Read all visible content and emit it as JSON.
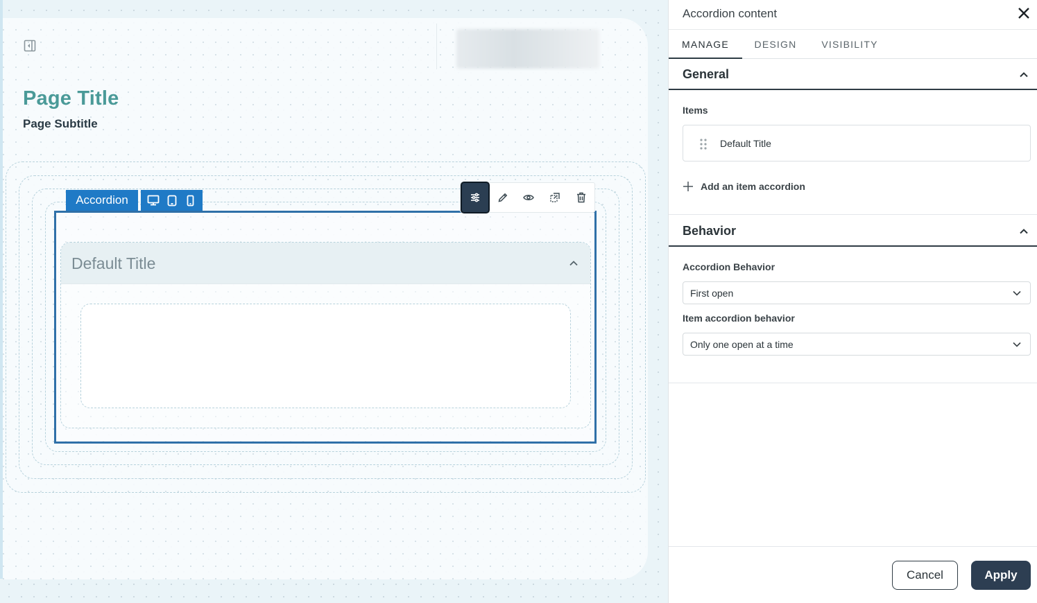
{
  "canvas": {
    "page_title": "Page Title",
    "page_subtitle": "Page Subtitle",
    "collapse_icon": "panel-collapse-icon",
    "component": {
      "tag_label": "Accordion",
      "device_icons": [
        "desktop-icon",
        "tablet-icon",
        "mobile-icon"
      ],
      "toolbar_icons": [
        "settings-sliders-icon",
        "pencil-icon",
        "eye-icon",
        "duplicate-icon",
        "trash-icon"
      ],
      "item_title": "Default Title"
    }
  },
  "panel": {
    "title": "Accordion content",
    "tabs": [
      {
        "label": "MANAGE",
        "active": true
      },
      {
        "label": "DESIGN",
        "active": false
      },
      {
        "label": "VISIBILITY",
        "active": false
      }
    ],
    "general": {
      "title": "General",
      "items_label": "Items",
      "items": [
        {
          "title": "Default Title"
        }
      ],
      "add_item_label": "Add an item accordion"
    },
    "behavior": {
      "title": "Behavior",
      "accordion_behavior_label": "Accordion Behavior",
      "accordion_behavior_value": "First open",
      "item_behavior_label": "Item accordion behavior",
      "item_behavior_value": "Only one open at a time"
    },
    "footer": {
      "cancel_label": "Cancel",
      "apply_label": "Apply"
    }
  },
  "colors": {
    "accent_blue": "#1f7ac6",
    "selection_border": "#2f70a8",
    "title_teal": "#4a9a98",
    "primary_dark": "#2d3e52"
  }
}
